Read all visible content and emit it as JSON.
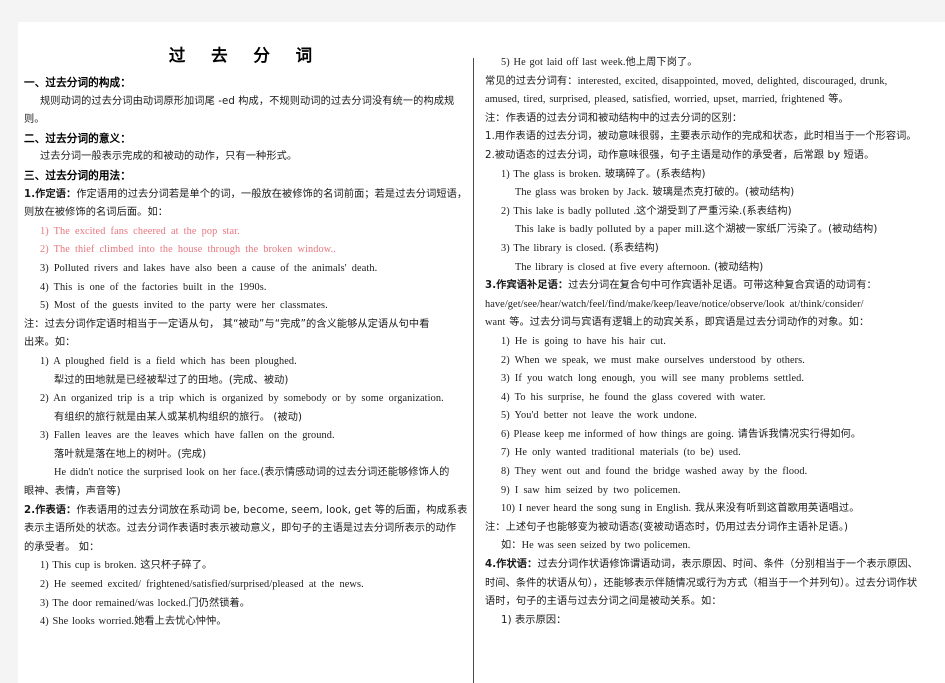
{
  "document": {
    "title": "过  去  分  词"
  },
  "left_column": {
    "lines": [
      {
        "kind": "heading",
        "text": "一、过去分词的构成："
      },
      {
        "kind": "cn",
        "indent": 1,
        "text": "规则动词的过去分词由动词原形加词尾 -ed 构成，不规则动词的过去分词没有统一的构成规"
      },
      {
        "kind": "cn",
        "indent": 0,
        "text": "则。"
      },
      {
        "kind": "heading",
        "text": "二、过去分词的意义："
      },
      {
        "kind": "cn",
        "indent": 1,
        "text": "过去分词一般表示完成的和被动的动作，只有一种形式。"
      },
      {
        "kind": "heading",
        "text": "三、过去分词的用法："
      },
      {
        "kind": "cn_lead",
        "lead": "1.作定语：",
        "text": "作定语用的过去分词若是单个的词，一般放在被修饰的名词前面；若是过去分词短语，"
      },
      {
        "kind": "cn",
        "indent": 0,
        "text": "则放在被修饰的名词后面。如："
      },
      {
        "kind": "eng_red",
        "indent": 1,
        "text": "1) The excited fans cheered at the pop star."
      },
      {
        "kind": "eng_red",
        "indent": 1,
        "text": "2) The thief climbed into the house through the broken window.."
      },
      {
        "kind": "eng",
        "indent": 1,
        "text": "3) Polluted rivers and lakes have also been a cause of the animals' death."
      },
      {
        "kind": "eng",
        "indent": 1,
        "text": "4) This is one of the factories built in the 1990s."
      },
      {
        "kind": "eng",
        "indent": 1,
        "text": "5) Most of the guests invited to the party were her classmates."
      },
      {
        "kind": "cn",
        "indent": 0,
        "text": "注：过去分词作定语时相当于一定语从句， 其“被动”与“完成”的含义能够从定语从句中看"
      },
      {
        "kind": "cn",
        "indent": 0,
        "text": "出来。如："
      },
      {
        "kind": "eng",
        "indent": 1,
        "text": "1) A ploughed field is a field which has been ploughed."
      },
      {
        "kind": "cn",
        "indent": 2,
        "text": "犁过的田地就是已经被犁过了的田地。(完成、被动)"
      },
      {
        "kind": "eng",
        "indent": 1,
        "text": "2) An organized trip is a trip which is organized by somebody or by some organization."
      },
      {
        "kind": "cn",
        "indent": 2,
        "text": "有组织的旅行就是由某人或某机构组织的旅行。 (被动)"
      },
      {
        "kind": "eng",
        "indent": 1,
        "text": "3) Fallen leaves are the leaves which have fallen on the ground."
      },
      {
        "kind": "cn",
        "indent": 2,
        "text": "落叶就是落在地上的树叶。(完成)"
      },
      {
        "kind": "mixed",
        "indent": 2,
        "eng": "He didn't notice the surprised look on her face.",
        "cn": "(表示情感动词的过去分词还能够修饰人的"
      },
      {
        "kind": "cn",
        "indent": 0,
        "text": "眼神、表情，声音等)"
      },
      {
        "kind": "cn_lead",
        "lead": "2.作表语：",
        "text": "作表语用的过去分词放在系动词 be, become, seem, look, get  等的后面，构成系表结构，"
      },
      {
        "kind": "cn",
        "indent": 0,
        "text": "表示主语所处的状态。过去分词作表语时表示被动意义，即句子的主语是过去分词所表示的动作"
      },
      {
        "kind": "cn",
        "indent": 0,
        "text": "的承受者。 如："
      },
      {
        "kind": "mixed",
        "indent": 1,
        "eng": "1) This cup is broken. ",
        "cn": "这只杯子碎了。"
      },
      {
        "kind": "eng",
        "indent": 1,
        "text": "2) He seemed excited/ frightened/satisfied/surprised/pleased at the news."
      },
      {
        "kind": "mixed",
        "indent": 1,
        "eng": "3) The door remained/was locked.",
        "cn": "门仍然锁着。"
      },
      {
        "kind": "mixed",
        "indent": 1,
        "eng": "4) She looks worried.",
        "cn": "她看上去忧心忡忡。"
      }
    ]
  },
  "right_column": {
    "lines": [
      {
        "kind": "mixed",
        "indent": 1,
        "eng": "5) He got laid off last week.",
        "cn": "他上周下岗了。"
      },
      {
        "kind": "mixed",
        "indent": 0,
        "cn_first": "常见的过去分词有：",
        "eng": "interested, excited, disappointed, moved, delighted, discouraged, drunk,"
      },
      {
        "kind": "mixed",
        "indent": 0,
        "eng": "amused, tired, surprised, pleased, satisfied, worried, upset, married, frightened ",
        "cn": "等。"
      },
      {
        "kind": "cn",
        "indent": 0,
        "text": "注：作表语的过去分词和被动结构中的过去分词的区别："
      },
      {
        "kind": "cn",
        "indent": 0,
        "text": "1.用作表语的过去分词，被动意味很弱，主要表示动作的完成和状态，此时相当于一个形容词。"
      },
      {
        "kind": "cn",
        "indent": 0,
        "text": "2.被动语态的过去分词，动作意味很强，句子主语是动作的承受者，后常跟 by 短语。"
      },
      {
        "kind": "mixed",
        "indent": 1,
        "eng": "1) The glass is broken. ",
        "cn": "玻璃碎了。(系表结构)"
      },
      {
        "kind": "mixed",
        "indent": 2,
        "eng": "The glass was broken by Jack. ",
        "cn": "玻璃是杰克打破的。(被动结构)"
      },
      {
        "kind": "mixed",
        "indent": 1,
        "eng": "2) This lake is badly polluted .",
        "cn": "这个湖受到了严重污染.(系表结构)"
      },
      {
        "kind": "mixed",
        "indent": 2,
        "eng": "This lake is badly polluted by a paper mill.",
        "cn": "这个湖被一家纸厂污染了。(被动结构)"
      },
      {
        "kind": "mixed",
        "indent": 1,
        "eng": "3) The library is closed. ",
        "cn": "(系表结构)"
      },
      {
        "kind": "mixed",
        "indent": 2,
        "eng": "The library is closed at five every afternoon. ",
        "cn": "(被动结构)"
      },
      {
        "kind": "cn_lead",
        "lead": "3.作宾语补足语：",
        "text": "过去分词在复合句中可作宾语补足语。可带这种复合宾语的动词有："
      },
      {
        "kind": "eng",
        "indent": 0,
        "text": "have/get/see/hear/watch/feel/find/make/keep/leave/notice/observe/look  at/think/consider/"
      },
      {
        "kind": "mixed",
        "indent": 0,
        "eng": "want ",
        "cn": "等。过去分词与宾语有逻辑上的动宾关系，即宾语是过去分词动作的对象。如："
      },
      {
        "kind": "eng",
        "indent": 1,
        "text": "1) He is going to have his hair cut."
      },
      {
        "kind": "eng",
        "indent": 1,
        "text": "2) When we speak, we must make ourselves understood by others."
      },
      {
        "kind": "eng",
        "indent": 1,
        "text": "3) If you watch long enough, you will see many problems settled."
      },
      {
        "kind": "eng",
        "indent": 1,
        "text": "4) To his surprise, he found the glass covered with water."
      },
      {
        "kind": "eng",
        "indent": 1,
        "text": "5) You'd better not leave the work undone."
      },
      {
        "kind": "mixed",
        "indent": 1,
        "eng": "6) Please keep me informed of how things are going. ",
        "cn": "请告诉我情况实行得如何。"
      },
      {
        "kind": "eng",
        "indent": 1,
        "text": "7) He only wanted traditional materials (to be) used."
      },
      {
        "kind": "eng",
        "indent": 1,
        "text": "8) They went out and found the bridge washed away by the flood."
      },
      {
        "kind": "eng",
        "indent": 1,
        "text": "9) I saw him seized by two policemen."
      },
      {
        "kind": "mixed",
        "indent": 1,
        "eng": "10) I never heard the song sung in English. ",
        "cn": "我从来没有听到这首歌用英语唱过。"
      },
      {
        "kind": "cn",
        "indent": 0,
        "text": "注：上述句子也能够变为被动语态(变被动语态时，仍用过去分词作主语补足语。)"
      },
      {
        "kind": "mixed",
        "indent": 1,
        "cn_first": "如：",
        "eng": "He was seen seized by two policemen."
      },
      {
        "kind": "cn_lead",
        "lead": "4.作状语：",
        "text": "过去分词作状语修饰谓语动词，表示原因、时间、条件（分别相当于一个表示原因、"
      },
      {
        "kind": "cn",
        "indent": 0,
        "text": "时间、条件的状语从句），还能够表示伴随情况或行为方式（相当于一个并列句）。过去分词作状"
      },
      {
        "kind": "cn",
        "indent": 0,
        "text": "语时，句子的主语与过去分词之间是被动关系。如："
      },
      {
        "kind": "cn",
        "indent": 1,
        "text": "1) 表示原因："
      }
    ]
  }
}
